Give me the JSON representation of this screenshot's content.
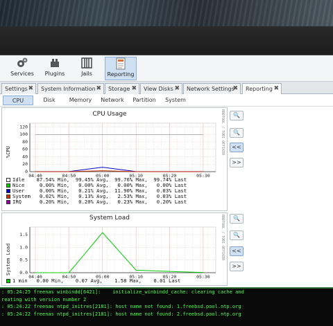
{
  "nav": {
    "items": [
      {
        "label": "Services",
        "icon": "gears-icon"
      },
      {
        "label": "Plugins",
        "icon": "plugin-icon"
      },
      {
        "label": "Jails",
        "icon": "jail-icon"
      },
      {
        "label": "Reporting",
        "icon": "reporting-icon"
      }
    ]
  },
  "tabs": [
    {
      "label": "Settings"
    },
    {
      "label": "System Information"
    },
    {
      "label": "Storage"
    },
    {
      "label": "View Disks"
    },
    {
      "label": "Network Settings"
    },
    {
      "label": "Reporting"
    }
  ],
  "subtabs": [
    "CPU",
    "Disk",
    "Memory",
    "Network",
    "Partition",
    "System"
  ],
  "controls": {
    "zoom_in": "+",
    "zoom_out": "−",
    "prev": "<<",
    "next": ">>"
  },
  "cpu": {
    "title": "CPU Usage",
    "ylabel": "%CPU",
    "side_label": "RRDTOOL / TOBI OETIKER",
    "yticks": [
      "0",
      "20",
      "40",
      "60",
      "80",
      "100",
      "120"
    ],
    "xticks": [
      "04:40",
      "04:50",
      "05:00",
      "05:10",
      "05:20",
      "05:30"
    ],
    "legend": [
      {
        "name": "Idle",
        "color": "#ffffff",
        "min": "87.54% Min,",
        "avg": "99.45% Avg,",
        "max": "99.76% Max,",
        "last": "99.74% Last"
      },
      {
        "name": "Nice",
        "color": "#00cc00",
        "min": " 0.00% Min,",
        "avg": " 0.00% Avg,",
        "max": " 0.00% Max,",
        "last": " 0.00% Last"
      },
      {
        "name": "User",
        "color": "#0000cc",
        "min": " 0.00% Min,",
        "avg": " 0.21% Avg,",
        "max": "11.90% Max,",
        "last": " 0.03% Last"
      },
      {
        "name": "System",
        "color": "#cc3300",
        "min": " 0.02% Min,",
        "avg": " 0.13% Avg,",
        "max": " 2.53% Max,",
        "last": " 0.03% Last"
      },
      {
        "name": "IRQ",
        "color": "#990099",
        "min": " 0.20% Min,",
        "avg": " 0.20% Avg,",
        "max": " 0.23% Max,",
        "last": " 0.20% Last"
      }
    ]
  },
  "load": {
    "title": "System Load",
    "ylabel": "System Load",
    "side_label": "RRDTOOL / TOBI OETIKER",
    "yticks": [
      "0.0",
      "0.5",
      "1.0",
      "1.5"
    ],
    "xticks": [
      "04:40",
      "04:50",
      "05:00",
      "05:10",
      "05:20",
      "05:30"
    ],
    "legend": [
      {
        "name": "1 min",
        "color": "#00cc00",
        "min": "0.00 Min,",
        "avg": "0.07 Avg,",
        "max": "1.58 Max,",
        "last": "0.01 Last"
      }
    ]
  },
  "chart_data": [
    {
      "type": "area",
      "title": "CPU Usage",
      "ylabel": "%CPU",
      "ylim": [
        0,
        130
      ],
      "x": [
        "04:40",
        "04:50",
        "05:00",
        "05:10",
        "05:20",
        "05:30"
      ],
      "series": [
        {
          "name": "Idle",
          "values": [
            99.7,
            99.7,
            99.7,
            99.7,
            99.7,
            99.7
          ]
        },
        {
          "name": "User",
          "values": [
            0.2,
            0.2,
            11.9,
            0.2,
            0.2,
            0.2
          ]
        },
        {
          "name": "System",
          "values": [
            0.1,
            0.1,
            2.5,
            0.1,
            0.1,
            0.1
          ]
        }
      ]
    },
    {
      "type": "line",
      "title": "System Load",
      "ylabel": "System Load",
      "ylim": [
        0,
        1.8
      ],
      "x": [
        "04:40",
        "04:50",
        "05:00",
        "05:10",
        "05:20",
        "05:30"
      ],
      "series": [
        {
          "name": "1 min",
          "values": [
            0.0,
            0.0,
            1.58,
            0.1,
            0.05,
            0.01
          ]
        }
      ]
    }
  ],
  "console": {
    "lines": [
      ": 05:24:25 freenas winbindd[6421]:    initialize_winbindd_cache: clearing cache and",
      "reating with version number 2",
      ": 05:24:22 freenas ntpd_initres[2181]: host name not found: 1.freebsd.pool.ntp.org",
      ": 05:24:22 freenas ntpd_initres[2181]: host name not found: 2.freebsd.pool.ntp.org"
    ]
  }
}
